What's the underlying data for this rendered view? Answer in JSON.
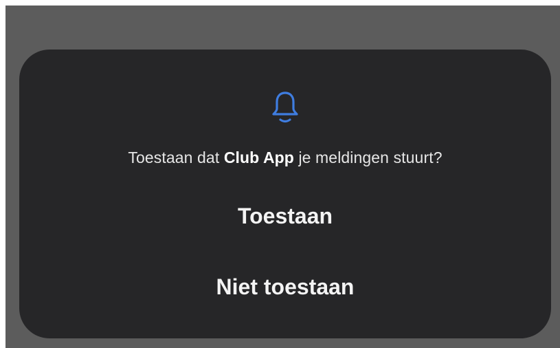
{
  "dialog": {
    "icon": "bell-icon",
    "accent_color": "#3f7de0",
    "message_prefix": "Toestaan dat ",
    "app_name": "Club App",
    "message_suffix": " je meldingen stuurt?",
    "allow_label": "Toestaan",
    "deny_label": "Niet toestaan"
  }
}
